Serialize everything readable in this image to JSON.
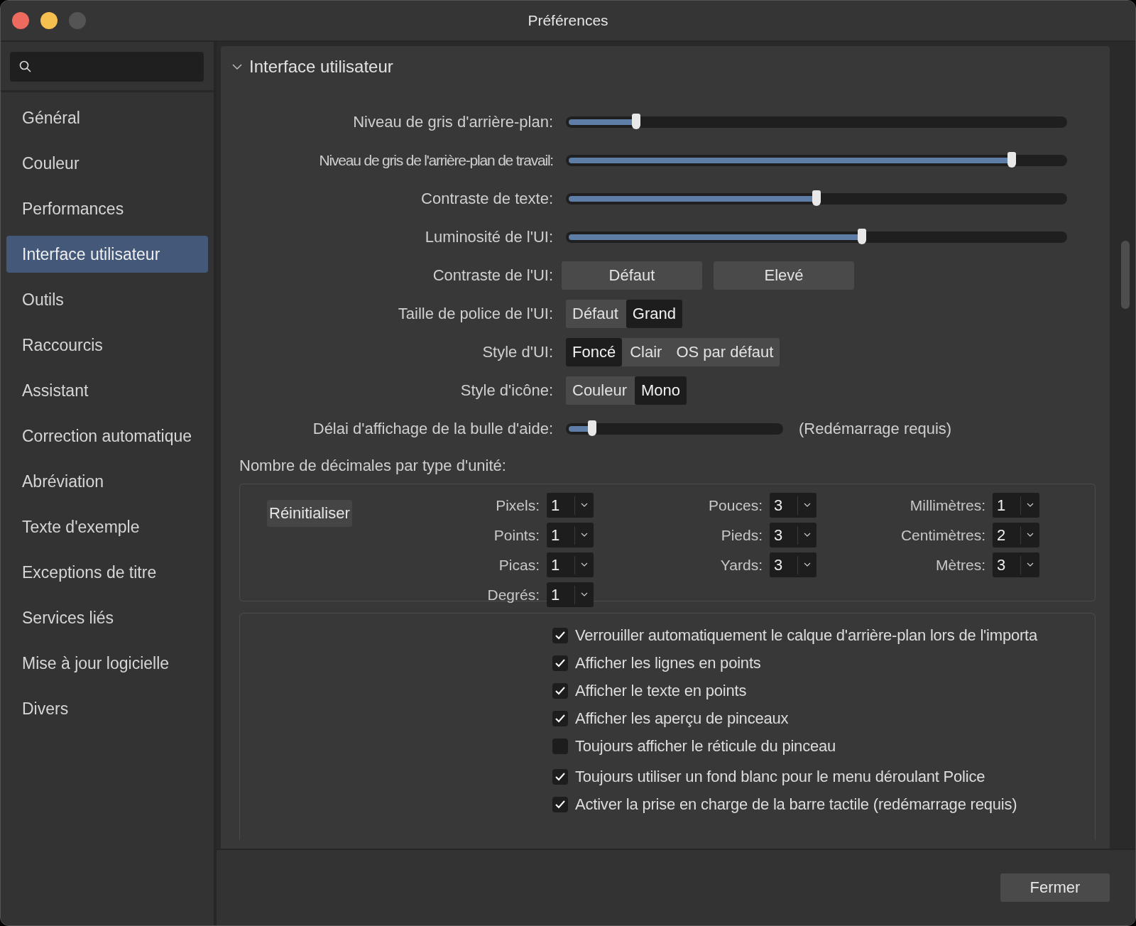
{
  "window": {
    "title": "Préférences"
  },
  "sidebar": {
    "items": [
      {
        "label": "Général",
        "selected": false
      },
      {
        "label": "Couleur",
        "selected": false
      },
      {
        "label": "Performances",
        "selected": false
      },
      {
        "label": "Interface utilisateur",
        "selected": true
      },
      {
        "label": "Outils",
        "selected": false
      },
      {
        "label": "Raccourcis",
        "selected": false
      },
      {
        "label": "Assistant",
        "selected": false
      },
      {
        "label": "Correction automatique",
        "selected": false
      },
      {
        "label": "Abréviation",
        "selected": false
      },
      {
        "label": "Texte d'exemple",
        "selected": false
      },
      {
        "label": "Exceptions de titre",
        "selected": false
      },
      {
        "label": "Services liés",
        "selected": false
      },
      {
        "label": "Mise à jour logicielle",
        "selected": false
      },
      {
        "label": "Divers",
        "selected": false
      }
    ]
  },
  "section": {
    "title": "Interface utilisateur",
    "expanded": true
  },
  "settings": [
    {
      "kind": "slider",
      "label": "Niveau de gris d'arrière-plan:",
      "level": 0.14
    },
    {
      "kind": "slider",
      "label": "Niveau de gris de l'arrière-plan de travail:",
      "level": 0.89
    },
    {
      "kind": "slider",
      "label": "Contraste de texte:",
      "level": 0.5
    },
    {
      "kind": "slider",
      "label": "Luminosité de l'UI:",
      "level": 0.59
    },
    {
      "kind": "buttons",
      "label": "Contraste de l'UI:",
      "options": [
        {
          "label": "Défaut"
        },
        {
          "label": "Elevé"
        }
      ]
    },
    {
      "kind": "segmented",
      "label": "Taille de police de l'UI:",
      "options": [
        {
          "label": "Défaut",
          "selected": false
        },
        {
          "label": "Grand",
          "selected": true
        }
      ]
    },
    {
      "kind": "segmented",
      "label": "Style d'UI:",
      "options": [
        {
          "label": "Foncé",
          "selected": true
        },
        {
          "label": "Clair",
          "selected": false
        },
        {
          "label": "OS par défaut",
          "selected": false
        }
      ]
    },
    {
      "kind": "segmented",
      "label": "Style d'icône:",
      "options": [
        {
          "label": "Couleur",
          "selected": false
        },
        {
          "label": "Mono",
          "selected": true
        }
      ]
    },
    {
      "kind": "short_slider",
      "label": "Délai d'affichage de la bulle d'aide:",
      "level": 0.12,
      "note": "(Redémarrage requis)"
    }
  ],
  "decimals": {
    "title": "Nombre de décimales par type d'unité:",
    "reset_button": "Réinitialiser",
    "columns": [
      [
        {
          "label": "Pixels:",
          "value": "1"
        },
        {
          "label": "Points:",
          "value": "1"
        },
        {
          "label": "Picas:",
          "value": "1"
        },
        {
          "label": "Degrés:",
          "value": "1"
        }
      ],
      [
        {
          "label": "Pouces:",
          "value": "3"
        },
        {
          "label": "Pieds:",
          "value": "3"
        },
        {
          "label": "Yards:",
          "value": "3"
        }
      ],
      [
        {
          "label": "Millimètres:",
          "value": "1"
        },
        {
          "label": "Centimètres:",
          "value": "2"
        },
        {
          "label": "Mètres:",
          "value": "3"
        }
      ]
    ]
  },
  "options": [
    {
      "label": "Verrouiller automatiquement le calque d'arrière-plan lors de l'importa",
      "checked": true
    },
    {
      "label": "Afficher les lignes en points",
      "checked": true
    },
    {
      "label": "Afficher le texte en points",
      "checked": true
    },
    {
      "label": "Afficher les aperçu de pinceaux",
      "checked": true
    },
    {
      "label": "Toujours afficher le réticule du pinceau",
      "checked": false
    },
    {
      "label": "Toujours utiliser un fond blanc pour le menu déroulant Police",
      "checked": true
    },
    {
      "label": "Activer la prise en charge de la barre tactile (redémarrage requis)",
      "checked": true
    }
  ],
  "footer": {
    "close_button": "Fermer"
  }
}
